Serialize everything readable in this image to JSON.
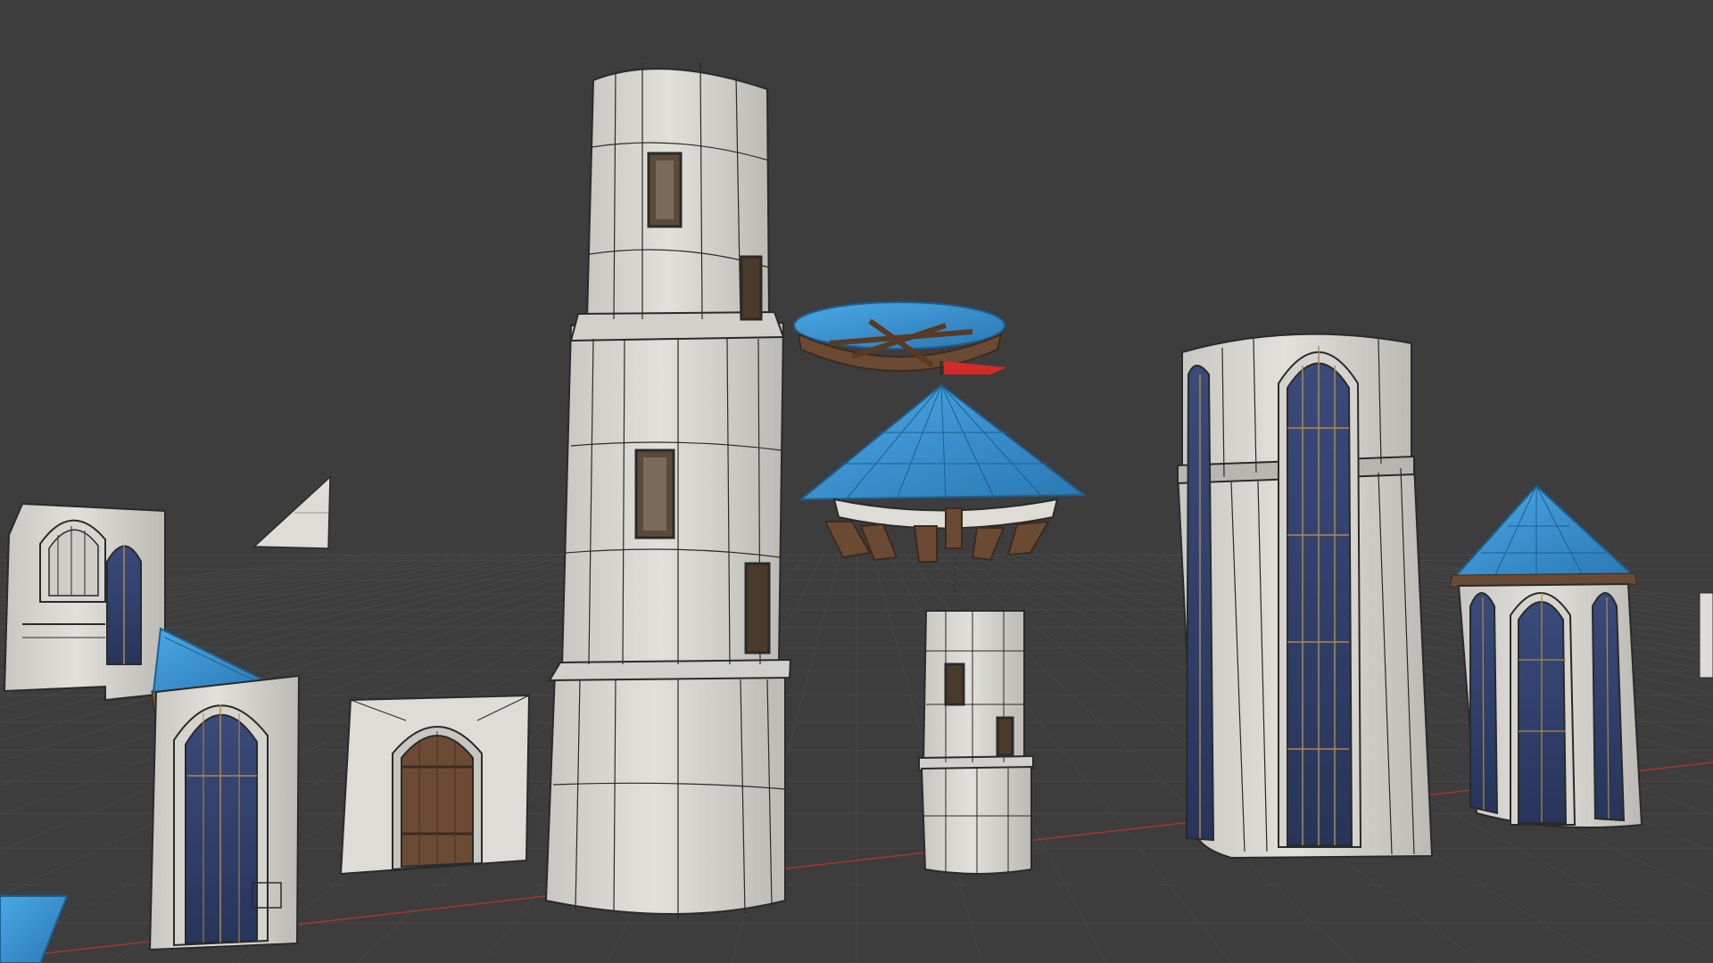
{
  "viewport": {
    "kind": "3D viewport",
    "colors": {
      "background": "#3d3d3d",
      "grid": "#4a4a4a",
      "x_axis": "#b33a3a",
      "stone": "#dcdad5",
      "stone_shade": "#c5c3bd",
      "seam": "#2a2a2a",
      "roof": "#3c9ad8",
      "roof_dark": "#2a78b4",
      "glass": "#2f3f6e",
      "wood": "#6a4a32",
      "flag": "#d42a2a"
    },
    "objects": [
      {
        "name": "wall-window-panel",
        "kind": "mesh"
      },
      {
        "name": "wedge-piece",
        "kind": "mesh"
      },
      {
        "name": "door-arch-blue-roof",
        "kind": "mesh"
      },
      {
        "name": "wooden-door-panel",
        "kind": "mesh"
      },
      {
        "name": "tall-stone-tower",
        "kind": "mesh"
      },
      {
        "name": "wooden-frame-cap",
        "kind": "mesh"
      },
      {
        "name": "conical-blue-roof",
        "kind": "mesh"
      },
      {
        "name": "small-stone-tower",
        "kind": "mesh"
      },
      {
        "name": "large-window-tower",
        "kind": "mesh"
      },
      {
        "name": "small-roofed-turret",
        "kind": "mesh"
      },
      {
        "name": "roof-fragment",
        "kind": "mesh"
      }
    ]
  }
}
